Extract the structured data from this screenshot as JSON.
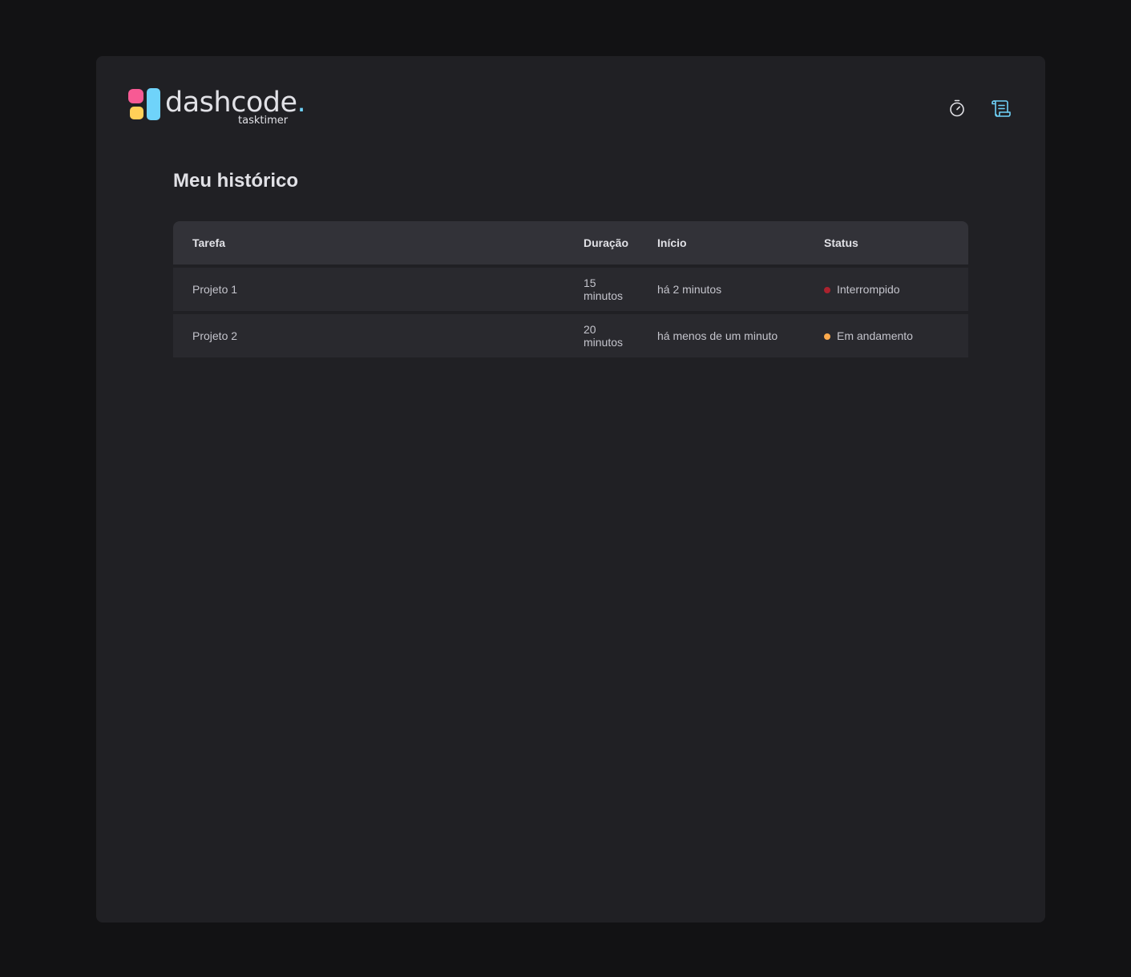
{
  "brand": {
    "name": "dashcode",
    "dot": ".",
    "subtitle": "tasktimer",
    "colors": {
      "pink": "#F75A94",
      "yellow": "#FFD058",
      "blue": "#6FD3FA"
    }
  },
  "nav": {
    "items": [
      {
        "icon": "timer-icon",
        "active": false,
        "color": "#E1E1E6"
      },
      {
        "icon": "scroll-icon",
        "active": true,
        "color": "#6FD3FA"
      }
    ]
  },
  "page": {
    "title": "Meu histórico"
  },
  "table": {
    "headers": [
      "Tarefa",
      "Duração",
      "Início",
      "Status"
    ],
    "rows": [
      {
        "task": "Projeto 1",
        "duration": "15 minutos",
        "start": "há 2 minutos",
        "status": "Interrompido",
        "status_color": "#AB222E"
      },
      {
        "task": "Projeto 2",
        "duration": "20 minutos",
        "start": "há menos de um minuto",
        "status": "Em andamento",
        "status_color": "#FBA94C"
      }
    ]
  }
}
